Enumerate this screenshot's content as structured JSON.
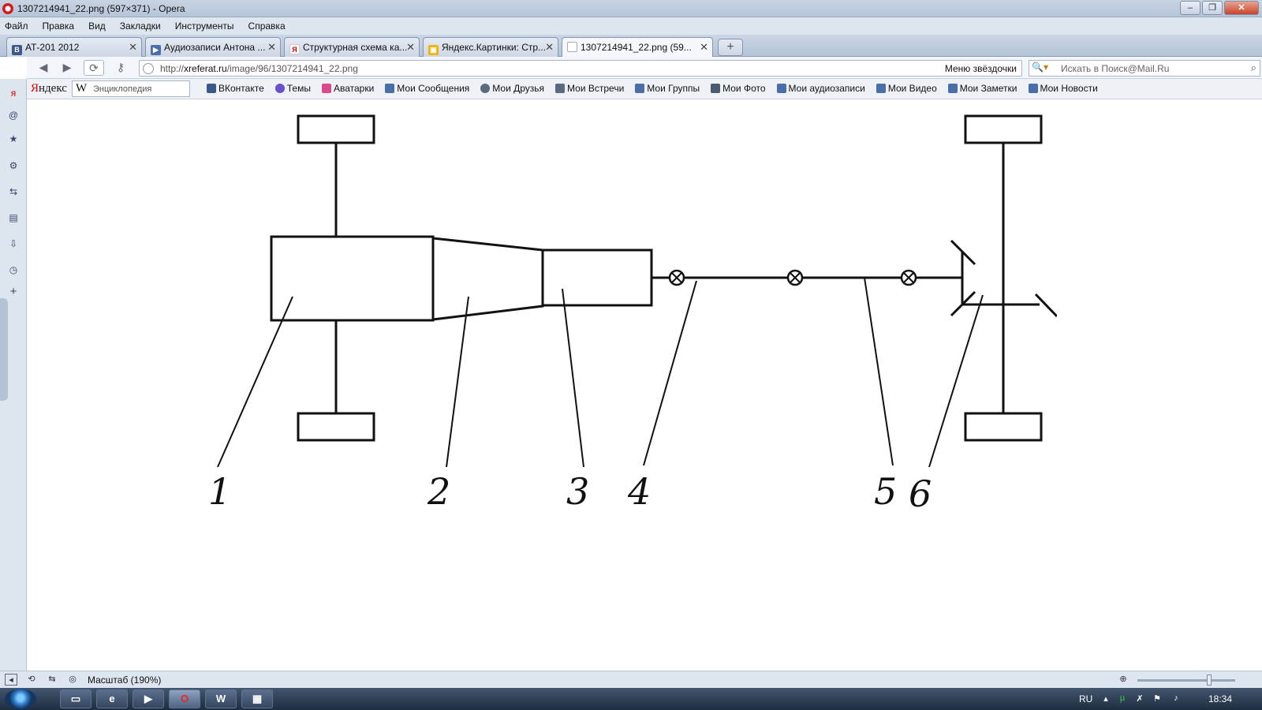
{
  "window": {
    "title": "1307214941_22.png (597×371) - Opera",
    "buttons": {
      "minimize": "–",
      "maximize": "❐",
      "close": "✕"
    }
  },
  "menu": [
    "Файл",
    "Правка",
    "Вид",
    "Закладки",
    "Инструменты",
    "Справка"
  ],
  "tabs": [
    {
      "label": "АТ-201 2012",
      "icon": "vk-icon",
      "close": "✕"
    },
    {
      "label": "Аудиозаписи Антона ...",
      "icon": "audio-icon",
      "close": "✕"
    },
    {
      "label": "Структурная схема ка...",
      "icon": "yandex-icon",
      "close": "✕"
    },
    {
      "label": "Яндекс.Картинки: Стр...",
      "icon": "images-icon",
      "close": "✕"
    },
    {
      "label": "1307214941_22.png (59...",
      "icon": "page-icon",
      "close": "✕",
      "active": true
    }
  ],
  "newtab": "+",
  "address": {
    "url_prefix": "http://",
    "url_domain": "xreferat.ru",
    "url_path": "/image/96/1307214941_22.png",
    "bookmark_label": "Меню звёздочки",
    "search_placeholder": "Искать в Поиск@Mail.Ru"
  },
  "yandex_bar": {
    "brand_first": "Я",
    "brand_rest": "ндекс",
    "wiki_placeholder": "Энциклопедия",
    "links": [
      {
        "label": "ВКонтакте",
        "icon": "vk-icon",
        "color": "#3b5a8a"
      },
      {
        "label": "Темы",
        "icon": "heart-icon",
        "color": "#6a4fd1"
      },
      {
        "label": "Аватарки",
        "icon": "star-icon",
        "color": "#d94a8c"
      },
      {
        "label": "Мои Сообщения",
        "icon": "envelope-icon",
        "color": "#4a6ea8"
      },
      {
        "label": "Мои Друзья",
        "icon": "person-icon",
        "color": "#5a6b80"
      },
      {
        "label": "Мои Встречи",
        "icon": "house-icon",
        "color": "#5a6b80"
      },
      {
        "label": "Мои Группы",
        "icon": "group-icon",
        "color": "#4a6ea8"
      },
      {
        "label": "Мои Фото",
        "icon": "camera-icon",
        "color": "#4a5a70"
      },
      {
        "label": "Мои аудиозаписи",
        "icon": "speaker-icon",
        "color": "#4a6ea8"
      },
      {
        "label": "Мои Видео",
        "icon": "film-icon",
        "color": "#4a6ea8"
      },
      {
        "label": "Мои Заметки",
        "icon": "note-icon",
        "color": "#4a6ea8"
      },
      {
        "label": "Мои Новости",
        "icon": "plus-icon",
        "color": "#4a6ea8"
      }
    ]
  },
  "diagram": {
    "labels": [
      "1",
      "2",
      "3",
      "4",
      "5",
      "6"
    ]
  },
  "status": {
    "zoom_label": "Масштаб (190%)"
  },
  "taskbar": {
    "lang": "RU",
    "clock": "18:34"
  }
}
